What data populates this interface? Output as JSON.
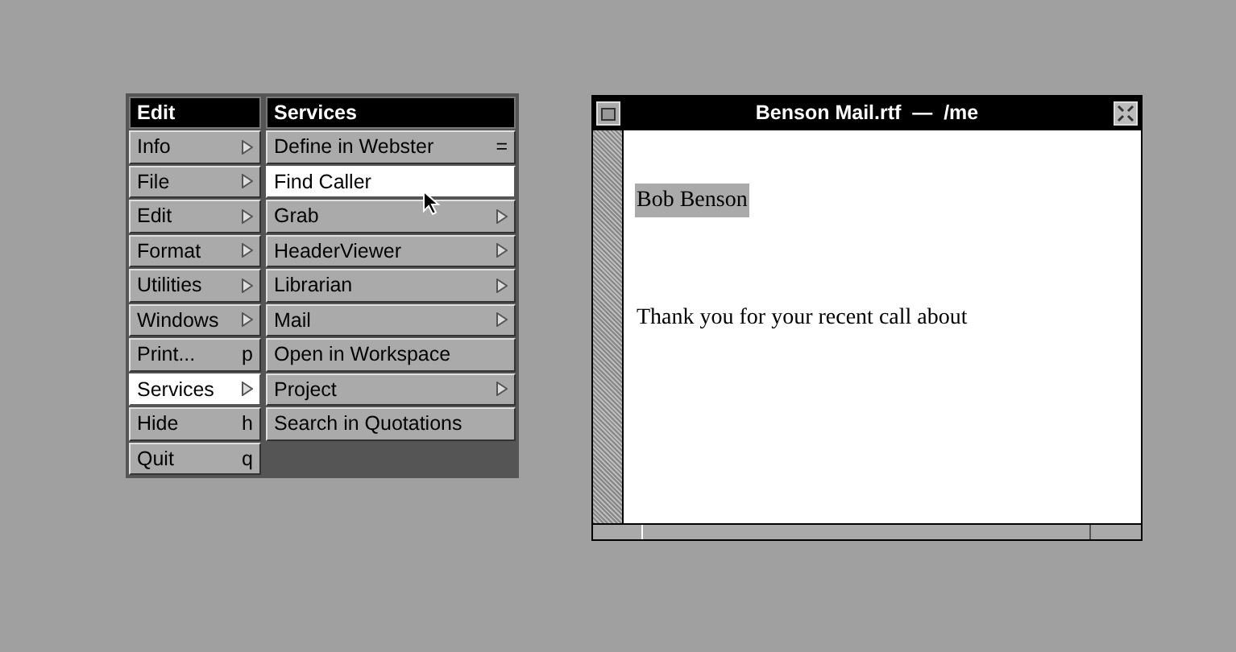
{
  "main_menu": {
    "title": "Edit",
    "items": [
      {
        "label": "Info",
        "kind": "submenu",
        "selected": false
      },
      {
        "label": "File",
        "kind": "submenu",
        "selected": false
      },
      {
        "label": "Edit",
        "kind": "submenu",
        "selected": false
      },
      {
        "label": "Format",
        "kind": "submenu",
        "selected": false
      },
      {
        "label": "Utilities",
        "kind": "submenu",
        "selected": false
      },
      {
        "label": "Windows",
        "kind": "submenu",
        "selected": false
      },
      {
        "label": "Print...",
        "kind": "key",
        "key": "p",
        "selected": false
      },
      {
        "label": "Services",
        "kind": "submenu",
        "selected": true
      },
      {
        "label": "Hide",
        "kind": "key",
        "key": "h",
        "selected": false
      },
      {
        "label": "Quit",
        "kind": "key",
        "key": "q",
        "selected": false
      }
    ]
  },
  "services_menu": {
    "title": "Services",
    "items": [
      {
        "label": "Define in Webster",
        "kind": "key",
        "key": "=",
        "selected": false
      },
      {
        "label": "Find Caller",
        "kind": "plain",
        "selected": true
      },
      {
        "label": "Grab",
        "kind": "submenu",
        "selected": false
      },
      {
        "label": "HeaderViewer",
        "kind": "submenu",
        "selected": false
      },
      {
        "label": "Librarian",
        "kind": "submenu",
        "selected": false
      },
      {
        "label": "Mail",
        "kind": "submenu",
        "selected": false
      },
      {
        "label": "Open in Workspace",
        "kind": "plain",
        "selected": false
      },
      {
        "label": "Project",
        "kind": "submenu",
        "selected": false
      },
      {
        "label": "Search in Quotations",
        "kind": "plain",
        "selected": false
      }
    ]
  },
  "document_window": {
    "title": "Benson Mail.rtf  —  /me",
    "paragraphs": [
      {
        "text": "Bob Benson",
        "selected": true
      },
      {
        "text": "Thank you for your recent call about",
        "selected": false
      }
    ]
  }
}
